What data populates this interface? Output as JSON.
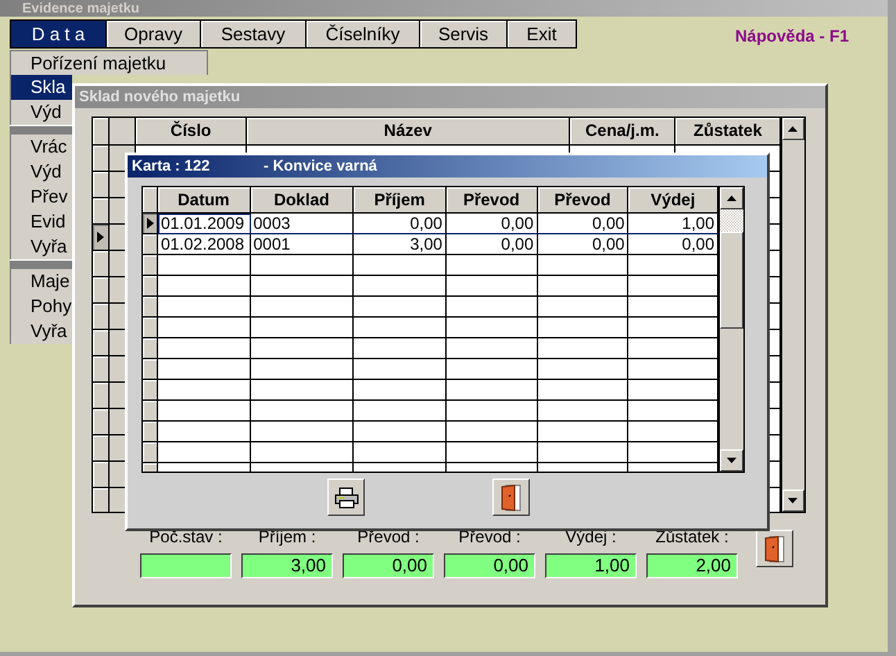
{
  "app": {
    "title": "Evidence majetku",
    "help": "Nápověda - F1"
  },
  "menu": [
    {
      "label": "D a t a",
      "selected": true
    },
    {
      "label": "Opravy",
      "selected": false
    },
    {
      "label": "Sestavy",
      "selected": false
    },
    {
      "label": "Číselníky",
      "selected": false
    },
    {
      "label": "Servis",
      "selected": false
    },
    {
      "label": "Exit",
      "selected": false
    }
  ],
  "dropdown": [
    [
      {
        "label": "Pořízení majetku",
        "selected": false
      },
      {
        "label": "Skla",
        "selected": true
      },
      {
        "label": "Výd",
        "selected": false
      }
    ],
    [
      {
        "label": "Vrác",
        "selected": false
      },
      {
        "label": "Výd",
        "selected": false
      },
      {
        "label": "Přev",
        "selected": false
      },
      {
        "label": "Evid",
        "selected": false
      },
      {
        "label": "Vyřa",
        "selected": false
      }
    ],
    [
      {
        "label": "Maje",
        "selected": false
      },
      {
        "label": "Pohy",
        "selected": false
      },
      {
        "label": "Vyřa",
        "selected": false
      }
    ]
  ],
  "sklad": {
    "title": "Sklad nového majetku",
    "columns": [
      "Číslo",
      "Název",
      "Cena/j.m.",
      "Zůstatek"
    ],
    "rows": [
      {
        "selected": false
      },
      {
        "selected": false
      },
      {
        "selected": false
      },
      {
        "selected": true
      },
      {
        "selected": false
      },
      {
        "selected": false
      },
      {
        "selected": false
      },
      {
        "selected": false
      },
      {
        "selected": false
      },
      {
        "selected": false
      },
      {
        "selected": false
      },
      {
        "selected": false
      },
      {
        "selected": false
      },
      {
        "selected": false
      }
    ],
    "totals": [
      {
        "label": "Poč.stav :"
      },
      {
        "label": "Příjem :",
        "value": "3,00"
      },
      {
        "label": "Převod :",
        "value": "0,00"
      },
      {
        "label": "Převod :",
        "value": "0,00"
      },
      {
        "label": "Výdej :",
        "value": "1,00"
      },
      {
        "label": "Zůstatek :",
        "value": "2,00"
      }
    ]
  },
  "karta": {
    "title": "Karta : 122",
    "subtitle": "- Konvice varná",
    "columns": [
      "Datum",
      "Doklad",
      "Příjem",
      "Převod",
      "Převod",
      "Výdej"
    ],
    "rows": [
      {
        "selected": true,
        "cells": [
          "01.01.2009",
          "0003",
          "0,00",
          "0,00",
          "0,00",
          "1,00"
        ]
      },
      {
        "selected": false,
        "cells": [
          "01.02.2008",
          "0001",
          "3,00",
          "0,00",
          "0,00",
          "0,00"
        ]
      }
    ]
  }
}
